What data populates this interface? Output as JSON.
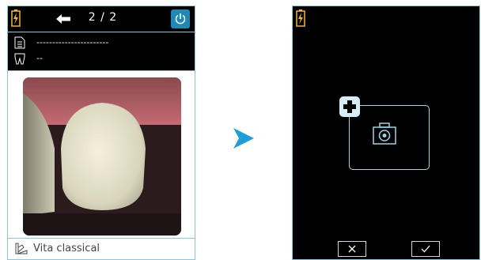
{
  "left_screen": {
    "page_counter": "2 / 2",
    "record_value": "-----------------------",
    "tooth_value": "--",
    "shade_guide": "Vita classical"
  },
  "colors": {
    "accent": "#1e88b7",
    "border": "#8ec6db",
    "battery": "#f2b632",
    "frame": "#9fd3e6"
  }
}
